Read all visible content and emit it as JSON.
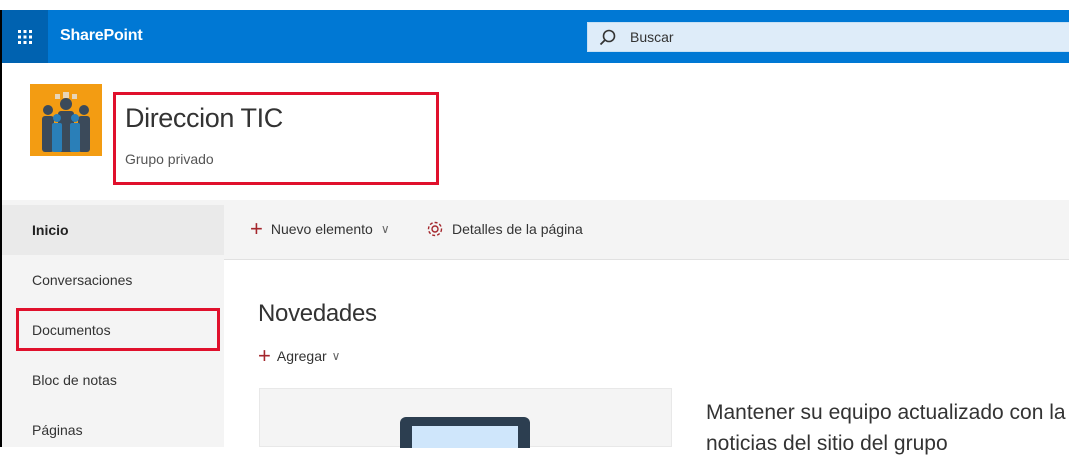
{
  "topbar": {
    "brand": "SharePoint",
    "search_placeholder": "Buscar"
  },
  "site": {
    "title": "Direccion TIC",
    "subtitle": "Grupo privado"
  },
  "nav": {
    "items": [
      {
        "label": "Inicio",
        "active": true
      },
      {
        "label": "Conversaciones"
      },
      {
        "label": "Documentos",
        "highlighted": true
      },
      {
        "label": "Bloc de notas"
      },
      {
        "label": "Páginas"
      }
    ]
  },
  "commandbar": {
    "new_item": "Nuevo elemento",
    "page_details": "Detalles de la página"
  },
  "main": {
    "title": "Novedades",
    "add_label": "Agregar",
    "promo_line1": "Mantener su equipo actualizado con la",
    "promo_line2": "noticias del sitio del grupo"
  },
  "colors": {
    "suitebar": "#0078d4",
    "accent": "#a4262c",
    "annotation": "#e0102c",
    "logo_bg": "#f39c12"
  }
}
